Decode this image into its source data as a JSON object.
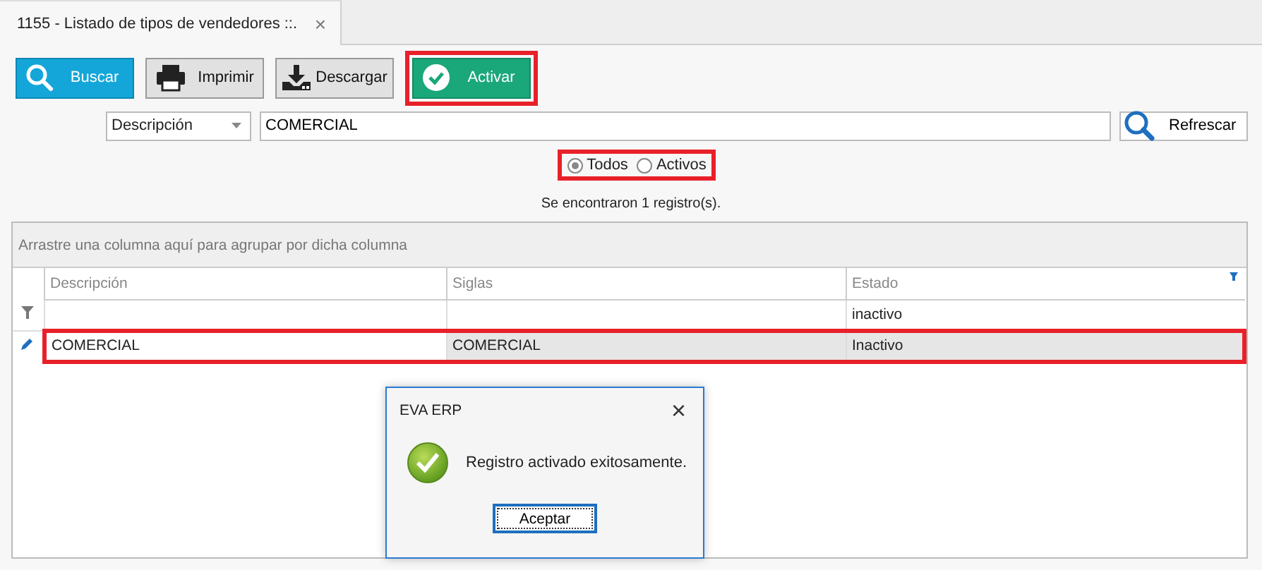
{
  "tab": {
    "title": "1155 - Listado de tipos de vendedores ::.",
    "close": "×"
  },
  "toolbar": [
    {
      "kind": "search",
      "label": "Buscar",
      "highlighted": false
    },
    {
      "kind": "print",
      "label": "Imprimir",
      "highlighted": false
    },
    {
      "kind": "download",
      "label": "Descargar",
      "highlighted": false
    },
    {
      "kind": "activate",
      "label": "Activar",
      "highlighted": true
    }
  ],
  "filter": {
    "field": "Descripción",
    "value": "COMERCIAL",
    "refresh": "Refrescar"
  },
  "radios": {
    "highlighted": true,
    "options": [
      {
        "label": "Todos",
        "selected": true
      },
      {
        "label": "Activos",
        "selected": false
      }
    ]
  },
  "status": "Se encontraron 1 registro(s).",
  "grid": {
    "group_hint": "Arrastre una columna aquí para agrupar por dicha columna",
    "columns": [
      {
        "label": "Descripción",
        "filtered": false
      },
      {
        "label": "Siglas",
        "filtered": false
      },
      {
        "label": "Estado",
        "filtered": true,
        "filter_value": "inactivo"
      }
    ],
    "rows": [
      {
        "cells": [
          "COMERCIAL",
          "COMERCIAL",
          "Inactivo"
        ],
        "editing": true,
        "highlighted": true
      }
    ]
  },
  "dialog": {
    "title": "EVA ERP",
    "close": "×",
    "message": "Registro activado exitosamente.",
    "button": "Aceptar"
  }
}
